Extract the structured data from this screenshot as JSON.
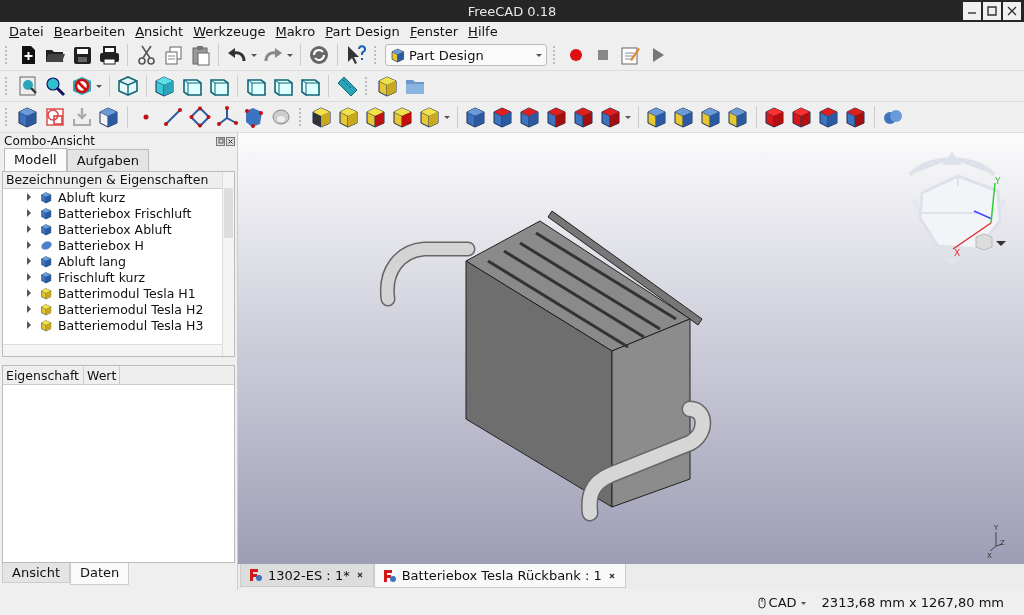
{
  "window": {
    "title": "FreeCAD 0.18"
  },
  "menu": [
    "Datei",
    "Bearbeiten",
    "Ansicht",
    "Werkzeuge",
    "Makro",
    "Part Design",
    "Fenster",
    "Hilfe"
  ],
  "workbench": {
    "value": "Part Design"
  },
  "combo_view": {
    "title": "Combo-Ansicht",
    "tabs": [
      {
        "label": "Modell",
        "selected": true
      },
      {
        "label": "Aufgaben",
        "selected": false
      }
    ],
    "tree_header": "Bezeichnungen & Eigenschaften",
    "tree_items": [
      {
        "label": "Abluft kurz",
        "kind": "body",
        "expanded": false
      },
      {
        "label": "Batteriebox Frischluft",
        "kind": "body",
        "expanded": false
      },
      {
        "label": "Batteriebox Abluft",
        "kind": "body",
        "expanded": false
      },
      {
        "label": "Batteriebox H",
        "kind": "cylinder",
        "expanded": false
      },
      {
        "label": "Abluft lang",
        "kind": "body",
        "expanded": false
      },
      {
        "label": "Frischluft kurz",
        "kind": "body",
        "expanded": false
      },
      {
        "label": "Batterimodul Tesla H1",
        "kind": "module",
        "expanded": false
      },
      {
        "label": "Batteriemodul Tesla H2",
        "kind": "module",
        "expanded": false
      },
      {
        "label": "Batteriemodul Tesla H3",
        "kind": "module",
        "expanded": false
      }
    ],
    "property_columns": [
      "Eigenschaft",
      "Wert"
    ],
    "bottom_tabs": [
      {
        "label": "Ansicht",
        "selected": false
      },
      {
        "label": "Daten",
        "selected": true
      }
    ]
  },
  "navigation_cube": {
    "axes": [
      "Y",
      "X"
    ]
  },
  "axis_triad": {
    "axes": [
      "Y",
      "Z",
      "X"
    ]
  },
  "document_tabs": [
    {
      "label": "1302-ES : 1*",
      "selected": false
    },
    {
      "label": "Batteriebox Tesla Rückbank : 1",
      "selected": true
    }
  ],
  "status_bar": {
    "navigation": "CAD",
    "dimensions": "2313,68 mm x 1267,80 mm"
  }
}
